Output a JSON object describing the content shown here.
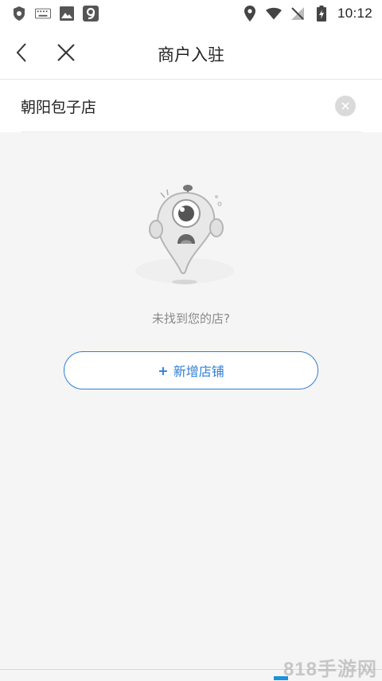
{
  "status_bar": {
    "time": "10:12",
    "left_icons": [
      "shield-icon",
      "keyboard-icon",
      "image-icon",
      "app-9-icon"
    ],
    "right_icons": [
      "location-icon",
      "wifi-icon",
      "no-sim-icon",
      "battery-charging-icon"
    ]
  },
  "header": {
    "title": "商户入驻",
    "back_icon": "chevron-left-icon",
    "close_icon": "close-icon"
  },
  "search": {
    "value": "朝阳包子店",
    "clear_icon": "clear-icon"
  },
  "empty_state": {
    "illustration": "crying-mascot-illustration",
    "message": "未找到您的店?",
    "add_button_label": "新增店铺",
    "add_button_prefix": "+"
  },
  "watermark": {
    "text": "818手游网"
  },
  "colors": {
    "accent": "#2f7fd6",
    "background": "#f5f5f5",
    "muted_text": "#8a8a8a"
  }
}
